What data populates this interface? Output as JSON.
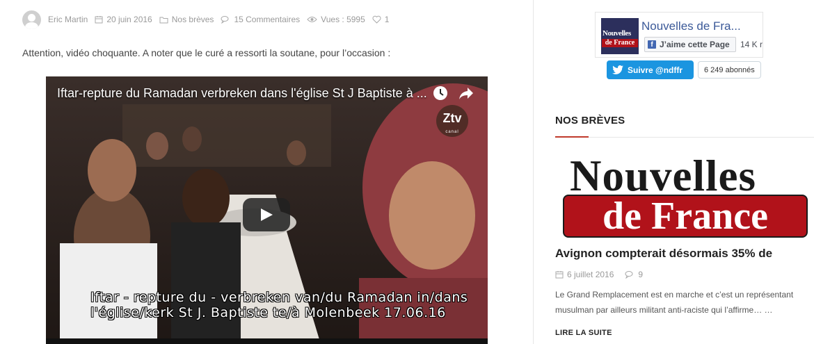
{
  "post": {
    "meta": {
      "author": "Eric Martin",
      "date": "20 juin 2016",
      "category": "Nos brèves",
      "comments": "15 Commentaires",
      "views": "Vues : 5995",
      "likes": "1"
    },
    "intro": "Attention, vidéo choquante. A noter que le curé a ressorti la soutane, pour l’occasion :",
    "video": {
      "title": "Iftar-repture du Ramadan verbreken dans l'église St J Baptiste à ...",
      "channel_logo": "Ztv",
      "channel_logo_sub": "canal",
      "subtitle_line1": "Iftar - repture du - verbreken van/du Ramadan in/dans",
      "subtitle_line2": "l'église/kerk St J. Baptiste te/à Molenbeek 17.06.16"
    }
  },
  "sidebar": {
    "facebook": {
      "page_name": "Nouvelles de Fra...",
      "like_label": "J’aime cette Page",
      "like_count": "14 K r",
      "thumb_line1": "Nouvelles",
      "thumb_line2": "de France"
    },
    "twitter": {
      "follow_label": "Suivre @ndffr",
      "followers": "6 249 abonnés"
    },
    "section_title": "NOS BRÈVES",
    "logo": {
      "line1": "Nouvelles",
      "line2": "de France"
    },
    "featured": {
      "title": "Avignon compterait désormais 35% de",
      "date": "6 juillet 2016",
      "comments": "9",
      "excerpt": "Le Grand Remplacement est en marche et c’est un représentant musulman par ailleurs militant anti-raciste qui l’affirme… …",
      "read_more": "LIRE LA SUITE"
    }
  },
  "colors": {
    "accent_red": "#c0392b",
    "facebook_blue": "#3b5998",
    "twitter_blue": "#1b95e0",
    "logo_red": "#b1121a"
  }
}
